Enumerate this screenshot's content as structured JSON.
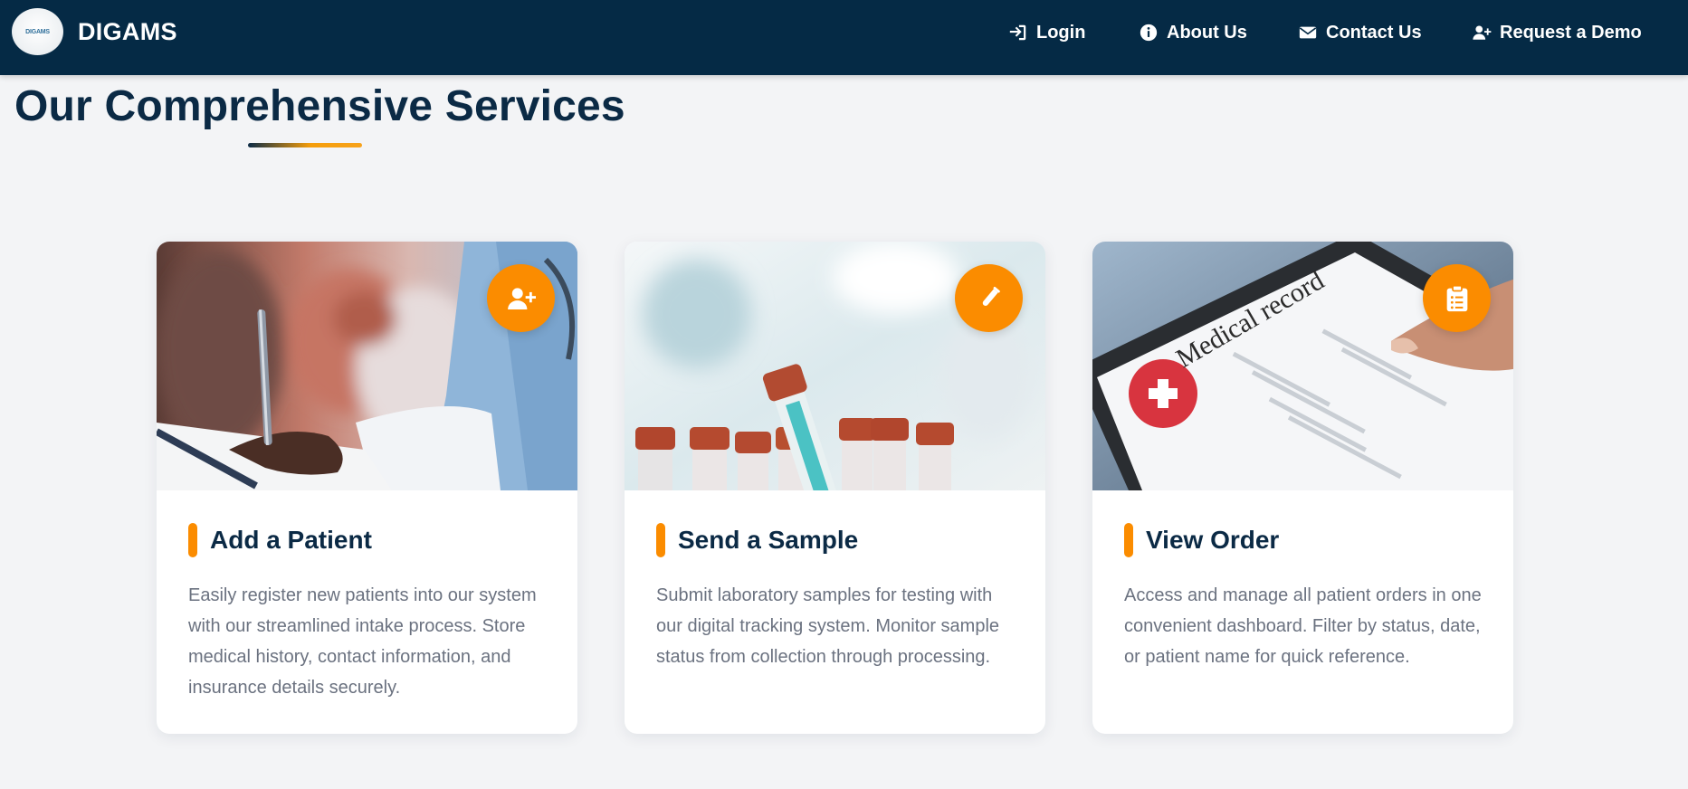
{
  "brand": {
    "name": "DIGAMS",
    "logo_text": "DIGAMS"
  },
  "nav": {
    "items": [
      {
        "label": "Login",
        "icon": "sign-in-icon"
      },
      {
        "label": "About Us",
        "icon": "info-circle-icon"
      },
      {
        "label": "Contact Us",
        "icon": "envelope-icon"
      },
      {
        "label": "Request a Demo",
        "icon": "user-plus-icon"
      }
    ]
  },
  "section": {
    "title": "Our Comprehensive Services"
  },
  "cards": [
    {
      "title": "Add a Patient",
      "icon": "user-plus-icon",
      "image": "doctor-writing-clipboard",
      "description": "Easily register new patients into our system with our streamlined intake process. Store medical history, contact information, and insurance details securely."
    },
    {
      "title": "Send a Sample",
      "icon": "test-tube-icon",
      "image": "blood-sample-tubes",
      "description": "Submit laboratory samples for testing with our digital tracking system. Monitor sample status from collection through processing."
    },
    {
      "title": "View Order",
      "icon": "clipboard-list-icon",
      "image": "medical-record-tablet",
      "image_caption": "Medical record",
      "description": "Access and manage all patient orders in one convenient dashboard. Filter by status, date, or patient name for quick reference."
    }
  ],
  "colors": {
    "navbar": "#052a45",
    "accent": "#fb8c00",
    "heading": "#0b2a45",
    "body_text": "#6b7280",
    "background": "#f3f4f6"
  }
}
